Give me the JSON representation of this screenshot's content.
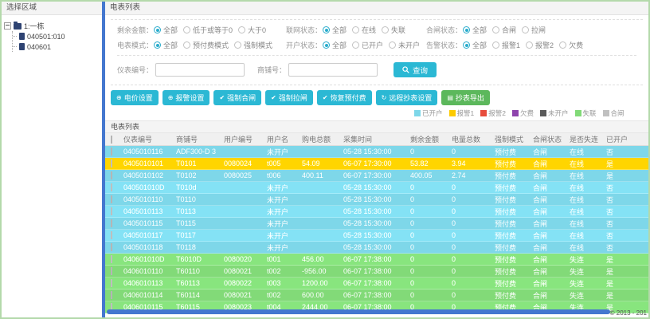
{
  "page": {
    "copyright": "© 2013 - 201"
  },
  "sidebar": {
    "title": "选择区域",
    "tree": {
      "root": "1:一栋",
      "children": [
        "040501:010",
        "040601"
      ]
    }
  },
  "main": {
    "title": "电表列表",
    "filters": {
      "rows": [
        [
          {
            "label": "剩余金额：",
            "options": [
              "全部",
              "低于或等于0",
              "大于0"
            ],
            "selected": 0
          },
          {
            "label": "联网状态：",
            "options": [
              "全部",
              "在线",
              "失联"
            ],
            "selected": 0
          },
          {
            "label": "合闸状态：",
            "options": [
              "全部",
              "合闸",
              "拉闸"
            ],
            "selected": 0
          }
        ],
        [
          {
            "label": "电表模式：",
            "options": [
              "全部",
              "预付费模式",
              "强制模式"
            ],
            "selected": 0
          },
          {
            "label": "开户状态：",
            "options": [
              "全部",
              "已开户",
              "未开户"
            ],
            "selected": 0
          },
          {
            "label": "告警状态：",
            "options": [
              "全部",
              "报警1",
              "报警2",
              "欠费"
            ],
            "selected": 0
          }
        ]
      ],
      "meter_no_label": "仪表编号：",
      "shop_no_label": "商铺号：",
      "search_button": "查询"
    },
    "toolbar": {
      "buttons": [
        {
          "label": "电价设置",
          "icon": "plus-circle-icon",
          "style": "cyan"
        },
        {
          "label": "报警设置",
          "icon": "plus-circle-icon",
          "style": "cyan"
        },
        {
          "label": "强制合闸",
          "icon": "check-icon",
          "style": "cyan"
        },
        {
          "label": "强制拉闸",
          "icon": "check-icon",
          "style": "cyan"
        },
        {
          "label": "恢复预付费",
          "icon": "check-icon",
          "style": "cyan"
        },
        {
          "label": "远程抄表设置",
          "icon": "refresh-icon",
          "style": "cyan"
        },
        {
          "label": "抄表导出",
          "icon": "file-icon",
          "style": "green"
        }
      ]
    },
    "legend": [
      {
        "label": "已开户",
        "color": "#7ed7e9"
      },
      {
        "label": "报警1",
        "color": "#fdcb00"
      },
      {
        "label": "报警2",
        "color": "#e74c3c"
      },
      {
        "label": "欠费",
        "color": "#8e44ad"
      },
      {
        "label": "未开户",
        "color": "#5a5a5a"
      },
      {
        "label": "失联",
        "color": "#82da78"
      },
      {
        "label": "合闸",
        "color": "#c0c0c0"
      }
    ],
    "table": {
      "title": "电表列表",
      "headers": [
        "仪表编号",
        "商铺号",
        "用户编号",
        "用户名",
        "购电总额",
        "采集时间",
        "剩余金额",
        "电量总数",
        "强制模式",
        "合闸状态",
        "是否失连",
        "已开户"
      ],
      "rows": [
        {
          "status": "已开户",
          "cells": [
            "0405010116",
            "ADF300-D 3",
            "",
            "未开户",
            "",
            "05-28 15:30:00",
            "0",
            "0",
            "预付费",
            "合闸",
            "在线",
            "否"
          ]
        },
        {
          "status": "报警1",
          "cells": [
            "0405010101",
            "T0101",
            "0080024",
            "t005",
            "54.09",
            "06-07 17:30:00",
            "53.82",
            "3.94",
            "预付费",
            "合闸",
            "在线",
            "是"
          ]
        },
        {
          "status": "已开户",
          "cells": [
            "0405010102",
            "T0102",
            "0080025",
            "t006",
            "400.11",
            "06-07 17:30:00",
            "400.05",
            "2.74",
            "预付费",
            "合闸",
            "在线",
            "是"
          ]
        },
        {
          "status": "已开户",
          "cells": [
            "040501010D",
            "T010d",
            "",
            "未开户",
            "",
            "05-28 15:30:00",
            "0",
            "0",
            "预付费",
            "合闸",
            "在线",
            "否"
          ]
        },
        {
          "status": "已开户",
          "cells": [
            "0405010110",
            "T0110",
            "",
            "未开户",
            "",
            "05-28 15:30:00",
            "0",
            "0",
            "预付费",
            "合闸",
            "在线",
            "否"
          ]
        },
        {
          "status": "已开户",
          "cells": [
            "0405010113",
            "T0113",
            "",
            "未开户",
            "",
            "05-28 15:30:00",
            "0",
            "0",
            "预付费",
            "合闸",
            "在线",
            "否"
          ]
        },
        {
          "status": "已开户",
          "cells": [
            "0405010115",
            "T0115",
            "",
            "未开户",
            "",
            "05-28 15:30:00",
            "0",
            "0",
            "预付费",
            "合闸",
            "在线",
            "否"
          ]
        },
        {
          "status": "已开户",
          "cells": [
            "0405010117",
            "T0117",
            "",
            "未开户",
            "",
            "05-28 15:30:00",
            "0",
            "0",
            "预付费",
            "合闸",
            "在线",
            "否"
          ]
        },
        {
          "status": "已开户",
          "cells": [
            "0405010118",
            "T0118",
            "",
            "未开户",
            "",
            "05-28 15:30:00",
            "0",
            "0",
            "预付费",
            "合闸",
            "在线",
            "否"
          ]
        },
        {
          "status": "失联",
          "cells": [
            "040601010D",
            "T6010D",
            "0080020",
            "t001",
            "456.00",
            "06-07 17:38:00",
            "0",
            "0",
            "预付费",
            "合闸",
            "失连",
            "是"
          ]
        },
        {
          "status": "失联",
          "cells": [
            "0406010110",
            "T60110",
            "0080021",
            "t002",
            "-956.00",
            "06-07 17:38:00",
            "0",
            "0",
            "预付费",
            "合闸",
            "失连",
            "是"
          ]
        },
        {
          "status": "失联",
          "cells": [
            "0406010113",
            "T60113",
            "0080022",
            "t003",
            "1200.00",
            "06-07 17:38:00",
            "0",
            "0",
            "预付费",
            "合闸",
            "失连",
            "是"
          ]
        },
        {
          "status": "失联",
          "cells": [
            "0406010114",
            "T60114",
            "0080021",
            "t002",
            "600.00",
            "06-07 17:38:00",
            "0",
            "0",
            "预付费",
            "合闸",
            "失连",
            "是"
          ]
        },
        {
          "status": "失联",
          "cells": [
            "0406010115",
            "T60115",
            "0080023",
            "t004",
            "2444.00",
            "06-07 17:38:00",
            "0",
            "0",
            "预付费",
            "合闸",
            "失连",
            "是"
          ]
        }
      ]
    }
  }
}
